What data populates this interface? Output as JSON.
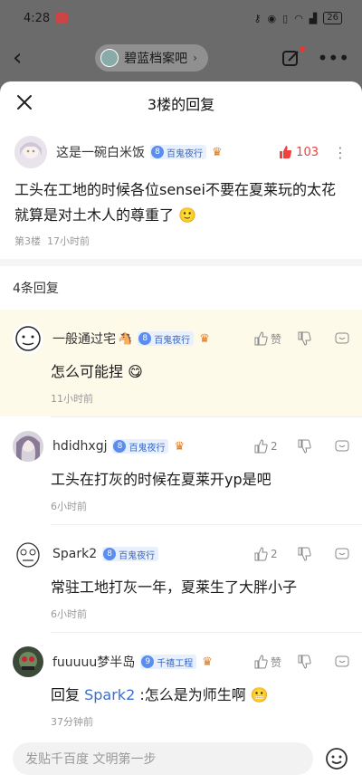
{
  "status_bar": {
    "time": "4:28",
    "battery": "26"
  },
  "background": {
    "forum_name": "碧蓝档案吧"
  },
  "sheet": {
    "title": "3楼的回复"
  },
  "main_post": {
    "username": "这是一碗白米饭",
    "level": "8",
    "level_title": "百鬼夜行",
    "likes": "103",
    "text": "工头在工地的时候各位sensei不要在夏莱玩的太花就算是对土木人的尊重了",
    "floor": "第3楼",
    "time": "17小时前"
  },
  "reply_count": "4条回复",
  "replies": [
    {
      "username": "一般通过宅",
      "level": "8",
      "level_title": "百鬼夜行",
      "like_label": "赞",
      "text": "怎么可能捏",
      "time": "11小时前"
    },
    {
      "username": "hdidhxgj",
      "level": "8",
      "level_title": "百鬼夜行",
      "like_label": "2",
      "text": "工头在打灰的时候在夏莱开yp是吧",
      "time": "6小时前"
    },
    {
      "username": "Spark2",
      "level": "8",
      "level_title": "百鬼夜行",
      "like_label": "2",
      "text": "常驻工地打灰一年，夏莱生了大胖小子",
      "time": "6小时前"
    },
    {
      "username": "fuuuuu梦半岛",
      "level": "9",
      "level_title": "千禧工程",
      "like_label": "赞",
      "reply_prefix": "回复",
      "mention": "Spark2",
      "text": " :怎么是为师生啊",
      "time": "37分钟前"
    }
  ],
  "input": {
    "placeholder": "发贴千百度 文明第一步"
  }
}
